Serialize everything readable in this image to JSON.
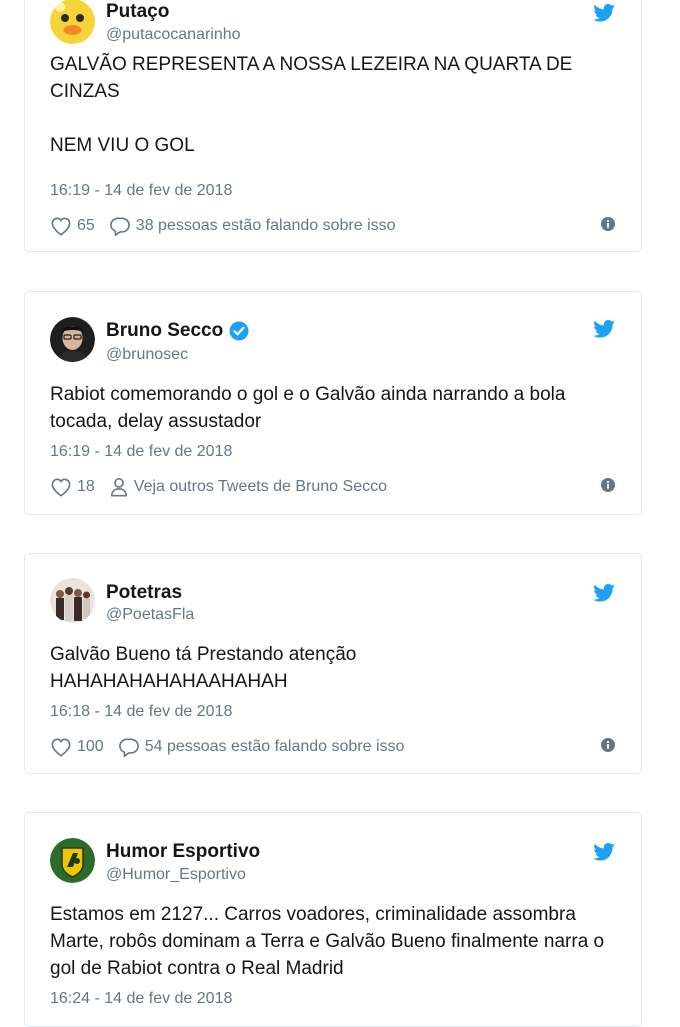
{
  "tweets": [
    {
      "display_name": "Putaço",
      "handle": "@putacocanarinho",
      "verified": false,
      "text": "GALVÃO REPRESENTA A NOSSA LEZEIRA NA QUARTA DE CINZAS\n\nNEM VIU O GOL",
      "timestamp": "16:19 - 14 de fev de 2018",
      "likes": "65",
      "secondary_action": "38 pessoas estão falando sobre isso"
    },
    {
      "display_name": "Bruno Secco",
      "handle": "@brunosec",
      "verified": true,
      "text": "Rabiot comemorando o gol e o Galvão ainda narrando a bola tocada, delay assustador",
      "timestamp": "16:19 - 14 de fev de 2018",
      "likes": "18",
      "secondary_action": "Veja outros Tweets de Bruno Secco"
    },
    {
      "display_name": "Potetras",
      "handle": "@PoetasFla",
      "verified": false,
      "text": "Galvão Bueno tá Prestando atenção\nHAHAHAHAHAHAAHAHAH",
      "timestamp": "16:18 - 14 de fev de 2018",
      "likes": "100",
      "secondary_action": "54 pessoas estão falando sobre isso"
    },
    {
      "display_name": "Humor Esportivo",
      "handle": "@Humor_Esportivo",
      "verified": false,
      "text": "Estamos em 2127... Carros voadores, criminalidade assombra Marte, robôs dominam a Terra e Galvão Bueno finalmente narra o gol de Rabiot contra o Real Madrid",
      "timestamp": "16:24 - 14 de fev de 2018"
    }
  ],
  "colors": {
    "brand_blue": "#1da1f2",
    "text": "#14171a",
    "muted": "#657786",
    "border": "#e1e8ed"
  },
  "icons": [
    "twitter-bird-icon",
    "heart-icon",
    "comment-icon",
    "person-icon",
    "info-icon",
    "verified-badge-icon"
  ]
}
